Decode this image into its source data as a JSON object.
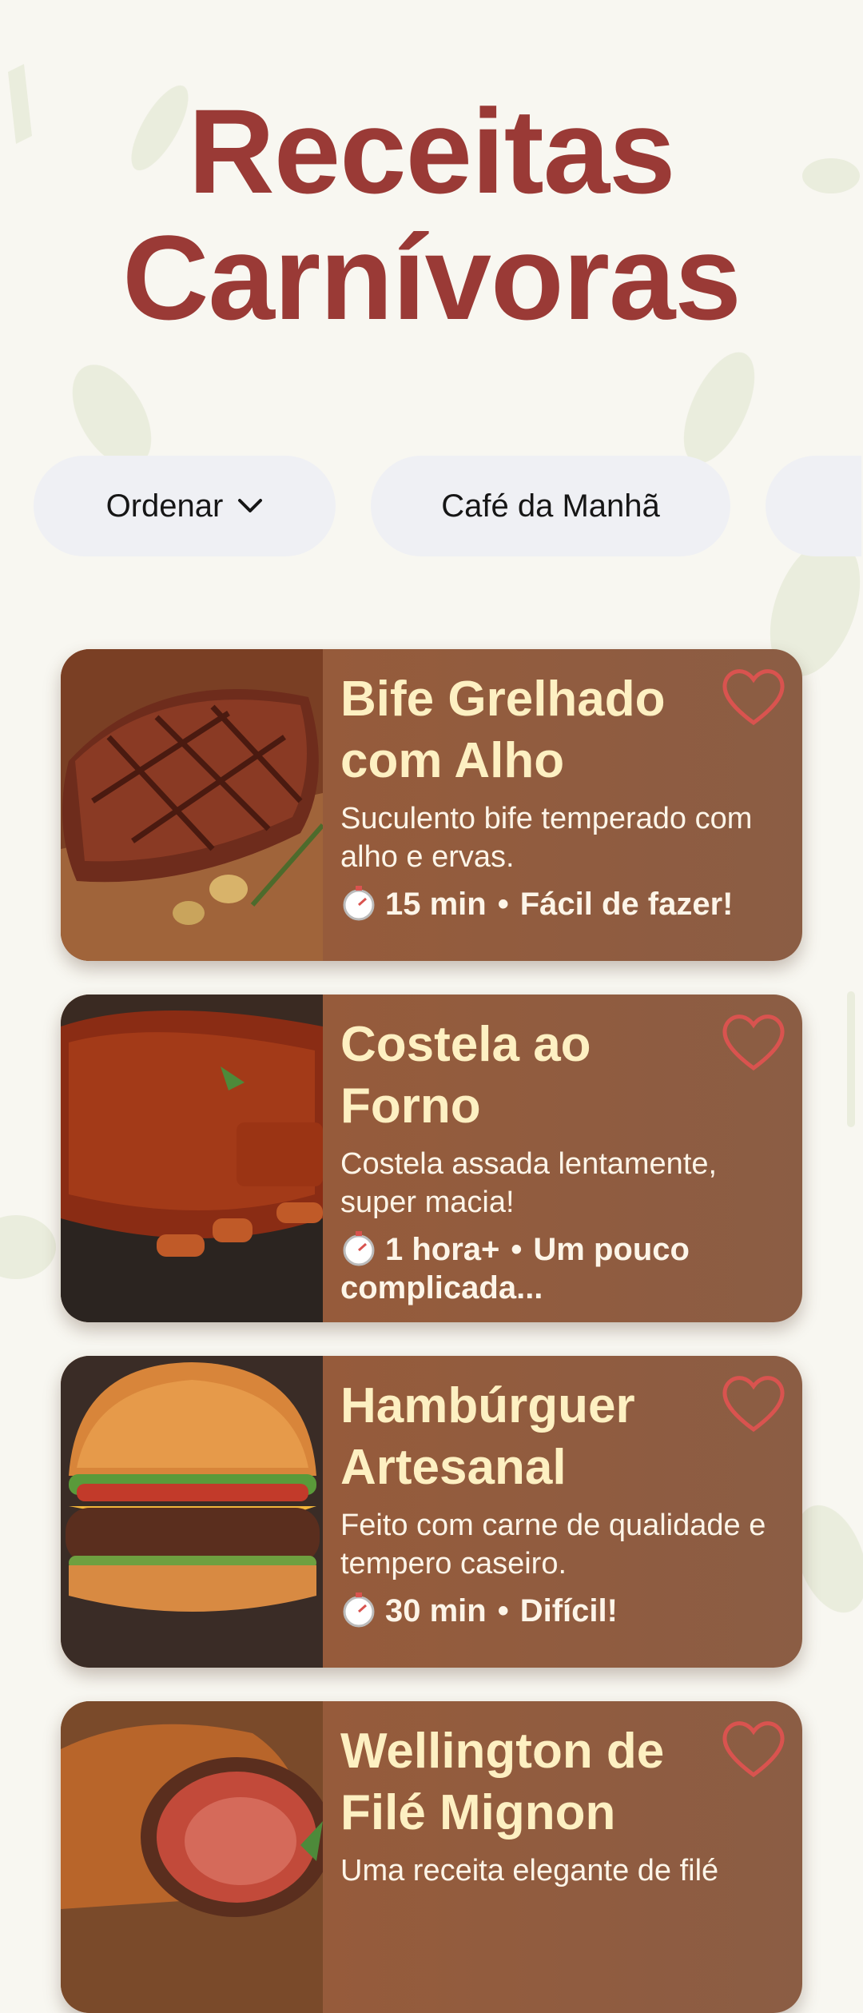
{
  "header": {
    "title_line1": "Receitas",
    "title_line2": "Carnívoras"
  },
  "filters": {
    "sort_label": "Ordenar",
    "categories": [
      "Café da Manhã",
      ""
    ]
  },
  "recipes": [
    {
      "title": "Bife Grelhado com Alho",
      "description": "Suculento bife temperado com alho e ervas.",
      "time": "15 min",
      "difficulty": "Fácil de fazer!"
    },
    {
      "title": "Costela ao Forno",
      "description": "Costela assada lentamente, super macia!",
      "time": "1 hora+",
      "difficulty": "Um pouco complicada..."
    },
    {
      "title": "Hambúrguer Artesanal",
      "description": "Feito com carne de qualidade e tempero caseiro.",
      "time": "30 min",
      "difficulty": "Difícil!"
    },
    {
      "title": "Wellington de Filé Mignon",
      "description": "Uma receita elegante de filé",
      "time": "",
      "difficulty": ""
    }
  ],
  "colors": {
    "title": "#9a3a36",
    "card": "#9c5a36",
    "card_title": "#fdf0c2",
    "heart": "#d9534f",
    "chip_bg": "#eff0f4",
    "background": "#f8f7f1"
  },
  "icons": {
    "sort": "chevron-down-icon",
    "favorite": "heart-icon",
    "time": "stopwatch-icon"
  }
}
